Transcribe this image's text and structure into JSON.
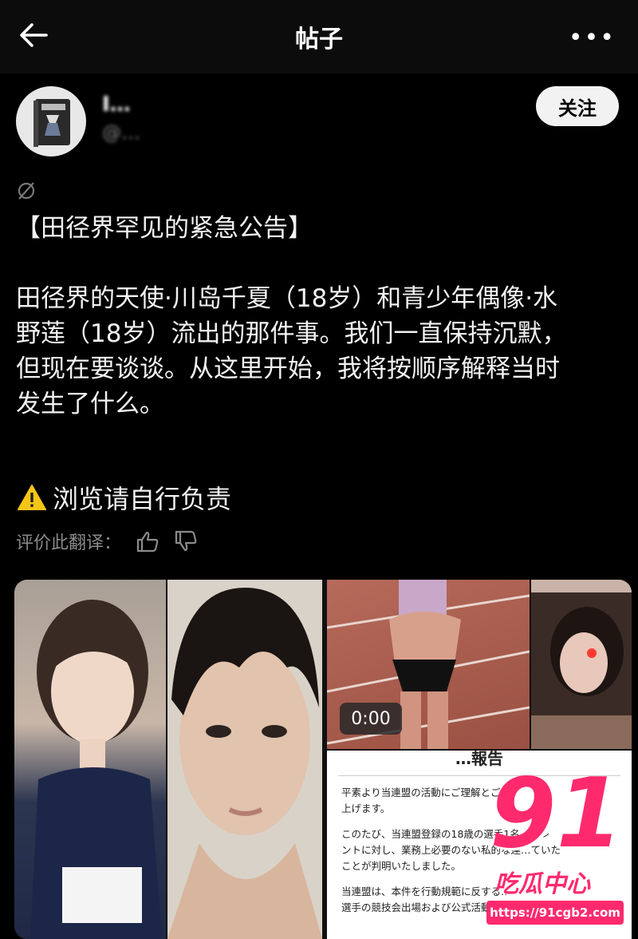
{
  "header": {
    "title": "帖子",
    "back_icon": "arrow-left-icon",
    "more_label": "•••"
  },
  "author": {
    "name": "I…",
    "handle": "@…",
    "follow_label": "关注"
  },
  "post": {
    "heading": "【田径界罕见的紧急公告】",
    "body_lines": [
      "田径界的天使·川岛千夏（18岁）和青少年偶像·水",
      "野莲（18岁）流出的那件事。我们一直保持沉默，",
      "但现在要谈谈。从这里开始，我将按顺序解释当时",
      "发生了什么。"
    ],
    "warning": "浏览请自行负责",
    "rate_label": "评价此翻译："
  },
  "media": {
    "video_duration": "0:00",
    "doc_header": "…報告",
    "doc_lines": [
      "平素より当連盟の活動にご理解とご…",
      "上げます。",
      "このたび、当連盟登録の18歳の選手1名…タレ",
      "ントに対し、業務上必要のない私的な連…ていた",
      "ことが判明いたしました。",
      "当連盟は、本件を行動規範に反する…",
      "選手の競技会出場および公式活動…"
    ]
  },
  "watermark": {
    "number": "91",
    "text": "吃瓜中心",
    "url": "https://91cgb2.com"
  },
  "colors": {
    "background": "#000000",
    "accent": "#ff2a6d",
    "muted": "#8a8a8a"
  }
}
